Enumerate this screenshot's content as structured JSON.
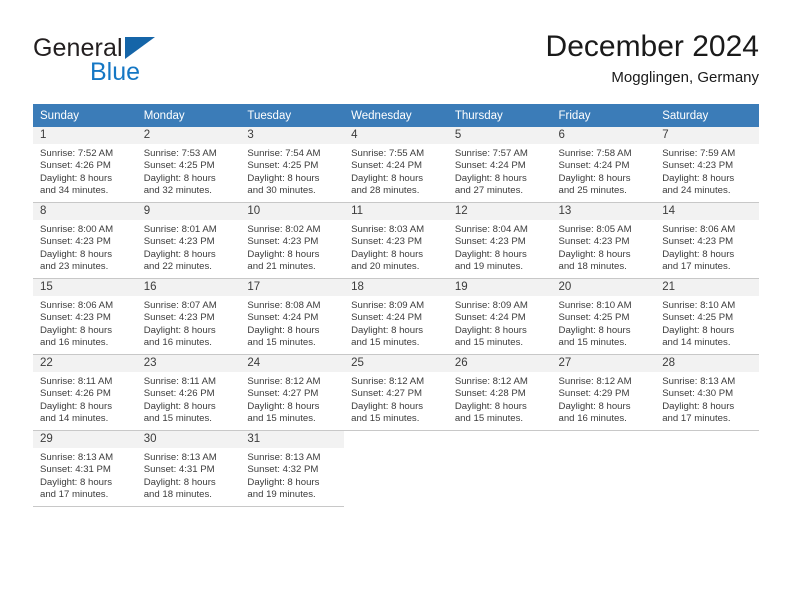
{
  "brand": {
    "name_top": "General",
    "name_bottom": "Blue",
    "triangle_icon": "triangle-icon",
    "color_dark": "#231f20",
    "color_blue": "#1577c4"
  },
  "header": {
    "title": "December 2024",
    "subtitle": "Mogglingen, Germany"
  },
  "theme": {
    "header_row_bg": "#3b7cb8",
    "daynum_bg": "#f2f2f2",
    "grid_line": "#c8c8c8",
    "text": "#3c3c3c"
  },
  "weekdays": [
    "Sunday",
    "Monday",
    "Tuesday",
    "Wednesday",
    "Thursday",
    "Friday",
    "Saturday"
  ],
  "weeks": [
    [
      {
        "day": "1",
        "sunrise": "Sunrise: 7:52 AM",
        "sunset": "Sunset: 4:26 PM",
        "daylight1": "Daylight: 8 hours",
        "daylight2": "and 34 minutes."
      },
      {
        "day": "2",
        "sunrise": "Sunrise: 7:53 AM",
        "sunset": "Sunset: 4:25 PM",
        "daylight1": "Daylight: 8 hours",
        "daylight2": "and 32 minutes."
      },
      {
        "day": "3",
        "sunrise": "Sunrise: 7:54 AM",
        "sunset": "Sunset: 4:25 PM",
        "daylight1": "Daylight: 8 hours",
        "daylight2": "and 30 minutes."
      },
      {
        "day": "4",
        "sunrise": "Sunrise: 7:55 AM",
        "sunset": "Sunset: 4:24 PM",
        "daylight1": "Daylight: 8 hours",
        "daylight2": "and 28 minutes."
      },
      {
        "day": "5",
        "sunrise": "Sunrise: 7:57 AM",
        "sunset": "Sunset: 4:24 PM",
        "daylight1": "Daylight: 8 hours",
        "daylight2": "and 27 minutes."
      },
      {
        "day": "6",
        "sunrise": "Sunrise: 7:58 AM",
        "sunset": "Sunset: 4:24 PM",
        "daylight1": "Daylight: 8 hours",
        "daylight2": "and 25 minutes."
      },
      {
        "day": "7",
        "sunrise": "Sunrise: 7:59 AM",
        "sunset": "Sunset: 4:23 PM",
        "daylight1": "Daylight: 8 hours",
        "daylight2": "and 24 minutes."
      }
    ],
    [
      {
        "day": "8",
        "sunrise": "Sunrise: 8:00 AM",
        "sunset": "Sunset: 4:23 PM",
        "daylight1": "Daylight: 8 hours",
        "daylight2": "and 23 minutes."
      },
      {
        "day": "9",
        "sunrise": "Sunrise: 8:01 AM",
        "sunset": "Sunset: 4:23 PM",
        "daylight1": "Daylight: 8 hours",
        "daylight2": "and 22 minutes."
      },
      {
        "day": "10",
        "sunrise": "Sunrise: 8:02 AM",
        "sunset": "Sunset: 4:23 PM",
        "daylight1": "Daylight: 8 hours",
        "daylight2": "and 21 minutes."
      },
      {
        "day": "11",
        "sunrise": "Sunrise: 8:03 AM",
        "sunset": "Sunset: 4:23 PM",
        "daylight1": "Daylight: 8 hours",
        "daylight2": "and 20 minutes."
      },
      {
        "day": "12",
        "sunrise": "Sunrise: 8:04 AM",
        "sunset": "Sunset: 4:23 PM",
        "daylight1": "Daylight: 8 hours",
        "daylight2": "and 19 minutes."
      },
      {
        "day": "13",
        "sunrise": "Sunrise: 8:05 AM",
        "sunset": "Sunset: 4:23 PM",
        "daylight1": "Daylight: 8 hours",
        "daylight2": "and 18 minutes."
      },
      {
        "day": "14",
        "sunrise": "Sunrise: 8:06 AM",
        "sunset": "Sunset: 4:23 PM",
        "daylight1": "Daylight: 8 hours",
        "daylight2": "and 17 minutes."
      }
    ],
    [
      {
        "day": "15",
        "sunrise": "Sunrise: 8:06 AM",
        "sunset": "Sunset: 4:23 PM",
        "daylight1": "Daylight: 8 hours",
        "daylight2": "and 16 minutes."
      },
      {
        "day": "16",
        "sunrise": "Sunrise: 8:07 AM",
        "sunset": "Sunset: 4:23 PM",
        "daylight1": "Daylight: 8 hours",
        "daylight2": "and 16 minutes."
      },
      {
        "day": "17",
        "sunrise": "Sunrise: 8:08 AM",
        "sunset": "Sunset: 4:24 PM",
        "daylight1": "Daylight: 8 hours",
        "daylight2": "and 15 minutes."
      },
      {
        "day": "18",
        "sunrise": "Sunrise: 8:09 AM",
        "sunset": "Sunset: 4:24 PM",
        "daylight1": "Daylight: 8 hours",
        "daylight2": "and 15 minutes."
      },
      {
        "day": "19",
        "sunrise": "Sunrise: 8:09 AM",
        "sunset": "Sunset: 4:24 PM",
        "daylight1": "Daylight: 8 hours",
        "daylight2": "and 15 minutes."
      },
      {
        "day": "20",
        "sunrise": "Sunrise: 8:10 AM",
        "sunset": "Sunset: 4:25 PM",
        "daylight1": "Daylight: 8 hours",
        "daylight2": "and 15 minutes."
      },
      {
        "day": "21",
        "sunrise": "Sunrise: 8:10 AM",
        "sunset": "Sunset: 4:25 PM",
        "daylight1": "Daylight: 8 hours",
        "daylight2": "and 14 minutes."
      }
    ],
    [
      {
        "day": "22",
        "sunrise": "Sunrise: 8:11 AM",
        "sunset": "Sunset: 4:26 PM",
        "daylight1": "Daylight: 8 hours",
        "daylight2": "and 14 minutes."
      },
      {
        "day": "23",
        "sunrise": "Sunrise: 8:11 AM",
        "sunset": "Sunset: 4:26 PM",
        "daylight1": "Daylight: 8 hours",
        "daylight2": "and 15 minutes."
      },
      {
        "day": "24",
        "sunrise": "Sunrise: 8:12 AM",
        "sunset": "Sunset: 4:27 PM",
        "daylight1": "Daylight: 8 hours",
        "daylight2": "and 15 minutes."
      },
      {
        "day": "25",
        "sunrise": "Sunrise: 8:12 AM",
        "sunset": "Sunset: 4:27 PM",
        "daylight1": "Daylight: 8 hours",
        "daylight2": "and 15 minutes."
      },
      {
        "day": "26",
        "sunrise": "Sunrise: 8:12 AM",
        "sunset": "Sunset: 4:28 PM",
        "daylight1": "Daylight: 8 hours",
        "daylight2": "and 15 minutes."
      },
      {
        "day": "27",
        "sunrise": "Sunrise: 8:12 AM",
        "sunset": "Sunset: 4:29 PM",
        "daylight1": "Daylight: 8 hours",
        "daylight2": "and 16 minutes."
      },
      {
        "day": "28",
        "sunrise": "Sunrise: 8:13 AM",
        "sunset": "Sunset: 4:30 PM",
        "daylight1": "Daylight: 8 hours",
        "daylight2": "and 17 minutes."
      }
    ],
    [
      {
        "day": "29",
        "sunrise": "Sunrise: 8:13 AM",
        "sunset": "Sunset: 4:31 PM",
        "daylight1": "Daylight: 8 hours",
        "daylight2": "and 17 minutes."
      },
      {
        "day": "30",
        "sunrise": "Sunrise: 8:13 AM",
        "sunset": "Sunset: 4:31 PM",
        "daylight1": "Daylight: 8 hours",
        "daylight2": "and 18 minutes."
      },
      {
        "day": "31",
        "sunrise": "Sunrise: 8:13 AM",
        "sunset": "Sunset: 4:32 PM",
        "daylight1": "Daylight: 8 hours",
        "daylight2": "and 19 minutes."
      },
      {
        "day": "",
        "sunrise": "",
        "sunset": "",
        "daylight1": "",
        "daylight2": ""
      },
      {
        "day": "",
        "sunrise": "",
        "sunset": "",
        "daylight1": "",
        "daylight2": ""
      },
      {
        "day": "",
        "sunrise": "",
        "sunset": "",
        "daylight1": "",
        "daylight2": ""
      },
      {
        "day": "",
        "sunrise": "",
        "sunset": "",
        "daylight1": "",
        "daylight2": ""
      }
    ]
  ]
}
